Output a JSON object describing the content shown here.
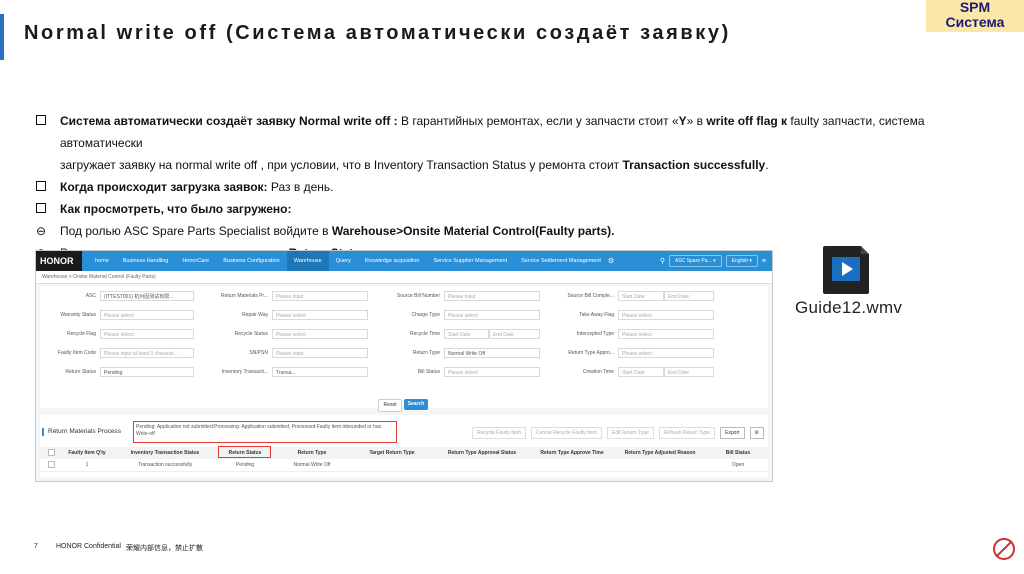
{
  "slide": {
    "title": "Normal write off (Система автоматически создаёт заявку)",
    "badge_line1": "SPM",
    "badge_line2": "Система",
    "bullets": [
      {
        "segs": [
          [
            "b",
            "Система автоматически создаёт заявку Normal write off : "
          ],
          [
            "t",
            "В гарантийных ремонтах, если у запчасти стоит «"
          ],
          [
            "b",
            "Y"
          ],
          [
            "t",
            "» в "
          ],
          [
            "b",
            "write off flag к"
          ],
          [
            "t",
            " faulty запчасти, система автоматически"
          ]
        ]
      },
      {
        "segs": [
          [
            "t",
            "загружает заявку на normal write off , при условии, что в Inventory Transaction Status у ремонта стоит "
          ],
          [
            "b",
            "Transaction successfully"
          ],
          [
            "t",
            "."
          ]
        ]
      },
      {
        "segs": [
          [
            "b",
            "Когда происходит загрузка заявок: "
          ],
          [
            "t",
            "Раз в день."
          ]
        ]
      },
      {
        "segs": [
          [
            "b",
            "Как просмотреть, что было загружено:"
          ]
        ]
      },
      {
        "segs": [
          [
            "t",
            "Под ролью ASC Spare Parts Specialist войдите в "
          ],
          [
            "b",
            "Warehouse>Onsite Material Control(Faulty parts)."
          ]
        ]
      },
      {
        "segs": [
          [
            "t",
            "Результаты заявки можно увидеть через "
          ],
          [
            "b",
            "Return Status"
          ],
          [
            "t",
            "."
          ]
        ]
      }
    ]
  },
  "app": {
    "logo": "HONOR",
    "nav": [
      "home",
      "Business Handling",
      "HonorCare",
      "Business Configuration",
      "Warehouse",
      "Query",
      "Knowledge acquisition",
      "Service Supplier Management",
      "Service Settlement Management"
    ],
    "active_nav": 4,
    "role_select": "ASC Spare Pa...",
    "lang_select": "English",
    "breadcrumb": "Warehouse > Onsite Material Control (Faulty Parts)",
    "form": {
      "asc_label": "ASC",
      "asc_value": "(ITTEST001) 杭州固测试有限...",
      "warranty_label": "Warranty Status",
      "recycle_flag_label": "Recycle Flag",
      "faulty_code_label": "Faulty Item Code",
      "faulty_code_ph": "Please input at least 3 characte...",
      "return_status_label": "Return Status",
      "return_status_value": "Pending",
      "rmp_label": "Return Materials Pr...",
      "repair_way_label": "Repair Way",
      "recycle_status_label": "Recycle Status",
      "sn_label": "SN/PSN",
      "inv_label": "Inventory Transacti...",
      "inv_value": "Transa...",
      "source_bill_label": "Source Bill Number",
      "charge_type_label": "Charge Type",
      "recycle_time_label": "Recycle Time",
      "return_type_label": "Return Type",
      "return_type_value": "Normal Write Off",
      "bill_status_label": "Bill Status",
      "sbc_label": "Source Bill Comple...",
      "take_away_label": "Take Away Flag",
      "intercepted_label": "Intercepted Type",
      "rta_label": "Return Type Appro...",
      "creation_label": "Creation Time",
      "ph_input": "Please input",
      "ph_select": "Please select",
      "ph_start": "Start Date",
      "ph_end": "End Date"
    },
    "reset_label": "Reset",
    "search_label": "Search",
    "section_title": "Return Materials Process",
    "tooltip": "Pending: Application not submitted;Processing: Application submitted; Processed:Faulty item inbounded or has Write-off",
    "toolbar": [
      "Recycle Faulty Item",
      "Cancel Recycle Faulty Item",
      "Edit Return Type",
      "Refresh Return Type"
    ],
    "export_label": "Export",
    "columns": [
      "Faulty Item Q'ty",
      "Inventory Transaction Status",
      "Return Status",
      "Return Type",
      "Target Return Type",
      "Return Type Approval Status",
      "Return Type Approve Time",
      "Return Type Adjusted Reason",
      "Bill Status"
    ],
    "row": [
      "1",
      "Transaction successfully",
      "Pending",
      "Normal Write Off",
      "",
      "",
      "",
      "",
      "Open"
    ]
  },
  "file": {
    "name": "Guide12.wmv"
  },
  "footer": {
    "page": "7",
    "text": "HONOR Confidential",
    "cn": "荣耀内部信息，禁止扩散"
  }
}
